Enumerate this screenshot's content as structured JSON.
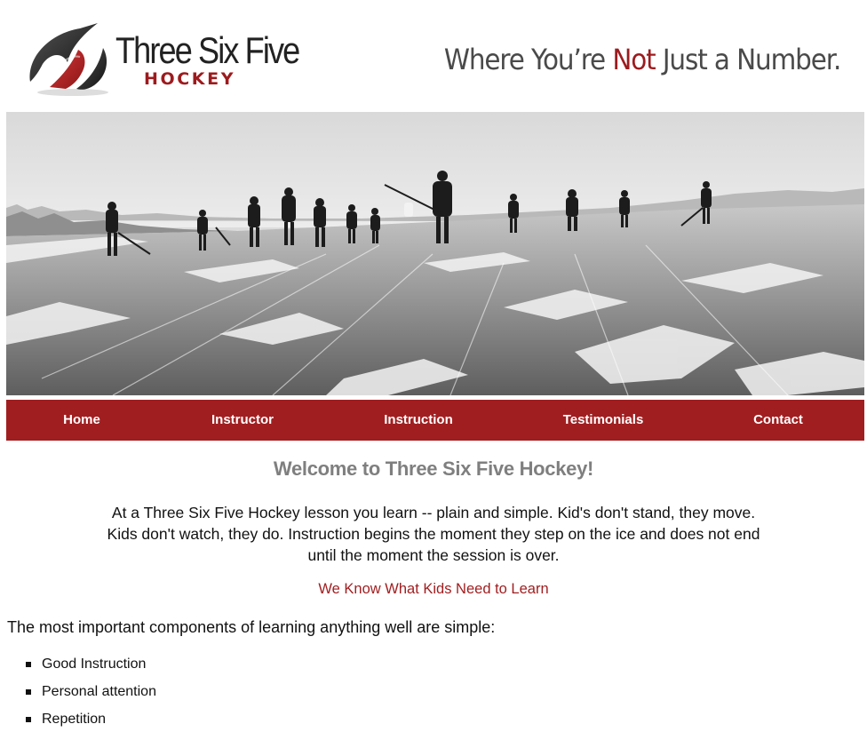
{
  "brand": {
    "title": "Three Six Five",
    "subtitle": "HOCKEY",
    "tagline_before": "Where You’re ",
    "tagline_accent": "Not",
    "tagline_after": " Just a Number."
  },
  "hero": {
    "image": "photo of hockey players skating on a snowy frozen lake"
  },
  "nav": {
    "items": [
      "Home",
      "Instructor",
      "Instruction",
      "Testimonials",
      "Contact"
    ]
  },
  "content": {
    "welcome": "Welcome to Three Six Five Hockey!",
    "intro": "At a Three Six Five Hockey lesson you learn -- plain and simple. Kid's don't stand, they move. Kids don't watch, they do. Instruction begins the moment they step on the ice and does not end until the moment the session is over.",
    "subhead": "We Know What Kids Need to Learn",
    "lead": "The most important components of learning anything well are simple:",
    "bullets": [
      "Good Instruction",
      "Personal attention",
      "Repetition"
    ]
  },
  "colors": {
    "brand_red": "#a11e20",
    "heading_gray": "#7f7f7f",
    "text": "#111111",
    "background": "#ffffff"
  }
}
